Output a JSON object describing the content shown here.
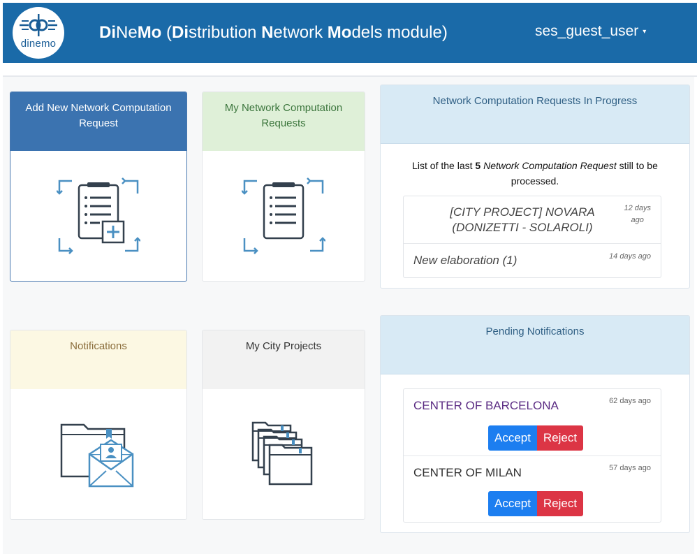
{
  "header": {
    "logo_text": "dinemo",
    "title_parts": [
      {
        "text": "Di",
        "bold": true
      },
      {
        "text": "Ne",
        "bold": false
      },
      {
        "text": "Mo",
        "bold": true
      },
      {
        "text": " (",
        "bold": false
      },
      {
        "text": "Di",
        "bold": true
      },
      {
        "text": "stribution ",
        "bold": false
      },
      {
        "text": "N",
        "bold": true
      },
      {
        "text": "etwork ",
        "bold": false
      },
      {
        "text": "Mo",
        "bold": true
      },
      {
        "text": "dels module)",
        "bold": false
      }
    ],
    "user": "ses_guest_user",
    "caret": "▾"
  },
  "colors": {
    "header_bg": "#1a6aa8",
    "accent_blue": "#3b73b0",
    "green_head": "#dff0d8",
    "green_text": "#3c763d",
    "yellow_head": "#fcf8e3",
    "yellow_text": "#8a6d3b",
    "gray_head": "#f2f2f2",
    "panel_head": "#d8eaf5",
    "accept": "#1c7ef0",
    "reject": "#dc3545",
    "purple_link": "#5b2c83"
  },
  "tiles": {
    "add_request": {
      "label": "Add New Network Computation Request",
      "icon": "clipboard-add-icon"
    },
    "my_requests": {
      "label": "My Network Computation Requests",
      "icon": "clipboard-list-icon"
    },
    "notifications": {
      "label": "Notifications",
      "icon": "folder-envelope-icon"
    },
    "city_projects": {
      "label": "My City Projects",
      "icon": "folder-stack-icon"
    }
  },
  "in_progress": {
    "title": "Network Computation Requests In Progress",
    "desc_prefix": "List of the last ",
    "desc_count": "5",
    "desc_italic": "Network Computation Request",
    "desc_suffix_1": " still to be",
    "desc_suffix_2": "processed.",
    "items": [
      {
        "name_line1": "[CITY PROJECT] NOVARA",
        "name_line2": "(DONIZETTI - SOLAROLI)",
        "time_line1": "12 days",
        "time_line2": "ago"
      },
      {
        "name": "New elaboration (1)",
        "time": "14 days ago"
      }
    ]
  },
  "pending": {
    "title": "Pending Notifications",
    "accept_label": "Accept",
    "reject_label": "Reject",
    "items": [
      {
        "name": "CENTER OF BARCELONA",
        "time": "62 days ago"
      },
      {
        "name": "CENTER OF MILAN",
        "time": "57 days ago"
      }
    ]
  }
}
